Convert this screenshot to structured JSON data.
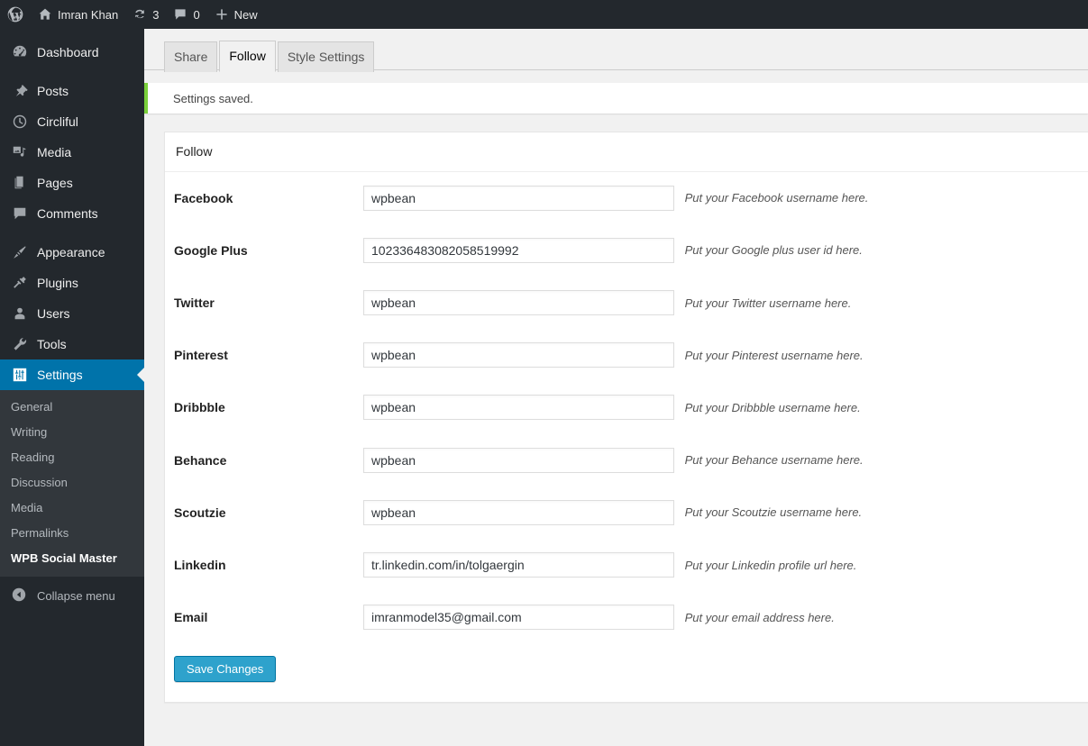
{
  "adminbar": {
    "wp_logo": "wordpress-logo-icon",
    "site_name": "Imran Khan",
    "site_icon": "home-icon",
    "updates_icon": "updates-icon",
    "updates_count": "3",
    "comments_icon": "comment-bubble-icon",
    "comments_count": "0",
    "new_icon": "plus-icon",
    "new_label": "New"
  },
  "sidebar": {
    "items": [
      {
        "label": "Dashboard",
        "icon": "dashboard-icon",
        "current": false
      },
      {
        "label": "Posts",
        "icon": "pin-icon",
        "current": false
      },
      {
        "label": "Circliful",
        "icon": "clock-icon",
        "current": false
      },
      {
        "label": "Media",
        "icon": "media-icon",
        "current": false
      },
      {
        "label": "Pages",
        "icon": "pages-icon",
        "current": false
      },
      {
        "label": "Comments",
        "icon": "comment-bubble-icon",
        "current": false
      },
      {
        "label": "Appearance",
        "icon": "paintbrush-icon",
        "current": false
      },
      {
        "label": "Plugins",
        "icon": "plug-icon",
        "current": false
      },
      {
        "label": "Users",
        "icon": "user-icon",
        "current": false
      },
      {
        "label": "Tools",
        "icon": "wrench-icon",
        "current": false
      },
      {
        "label": "Settings",
        "icon": "settings-sliders-icon",
        "current": true
      }
    ],
    "submenu": [
      {
        "label": "General",
        "current": false
      },
      {
        "label": "Writing",
        "current": false
      },
      {
        "label": "Reading",
        "current": false
      },
      {
        "label": "Discussion",
        "current": false
      },
      {
        "label": "Media",
        "current": false
      },
      {
        "label": "Permalinks",
        "current": false
      },
      {
        "label": "WPB Social Master",
        "current": true
      }
    ],
    "collapse": {
      "label": "Collapse menu",
      "icon": "collapse-arrow-icon"
    }
  },
  "tabs": [
    {
      "label": "Share",
      "active": false
    },
    {
      "label": "Follow",
      "active": true
    },
    {
      "label": "Style Settings",
      "active": false
    }
  ],
  "notice": {
    "text": "Settings saved.",
    "accent": "#7ad03a"
  },
  "panel": {
    "title": "Follow",
    "fields": [
      {
        "label": "Facebook",
        "value": "wpbean",
        "desc": "Put your Facebook username here."
      },
      {
        "label": "Google Plus",
        "value": "102336483082058519992",
        "desc": "Put your Google plus user id here."
      },
      {
        "label": "Twitter",
        "value": "wpbean",
        "desc": "Put your Twitter username here."
      },
      {
        "label": "Pinterest",
        "value": "wpbean",
        "desc": "Put your Pinterest username here."
      },
      {
        "label": "Dribbble",
        "value": "wpbean",
        "desc": "Put your Dribbble username here."
      },
      {
        "label": "Behance",
        "value": "wpbean",
        "desc": "Put your Behance username here."
      },
      {
        "label": "Scoutzie",
        "value": "wpbean",
        "desc": "Put your Scoutzie username here."
      },
      {
        "label": "Linkedin",
        "value": "tr.linkedin.com/in/tolgaergin",
        "desc": "Put your Linkedin profile url here."
      },
      {
        "label": "Email",
        "value": "imranmodel35@gmail.com",
        "desc": "Put your email address here."
      }
    ],
    "submit_label": "Save Changes"
  },
  "colors": {
    "adminbar_bg": "#23282d",
    "sidebar_bg": "#23282d",
    "submenu_bg": "#32373c",
    "active_blue": "#0073aa",
    "button_blue": "#2ea2cc",
    "notice_green": "#7ad03a",
    "content_bg": "#f1f1f1"
  }
}
